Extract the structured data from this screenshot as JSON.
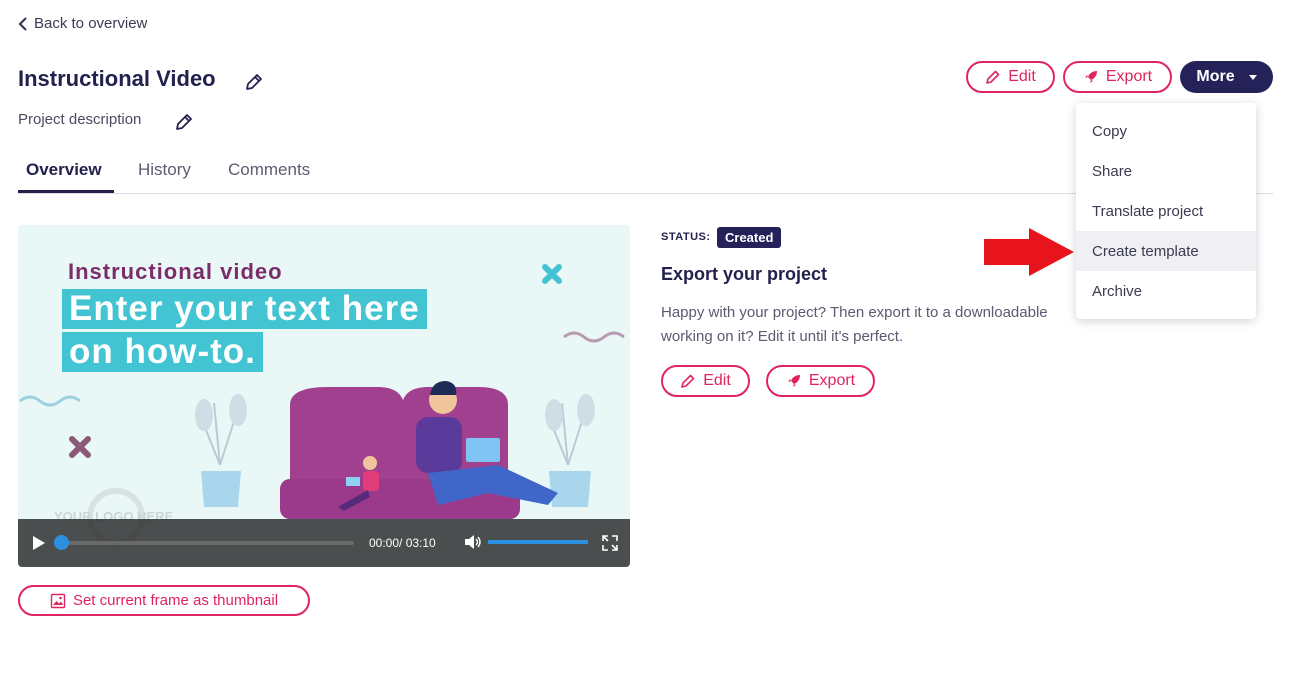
{
  "back_label": "Back to overview",
  "project": {
    "title": "Instructional Video",
    "description": "Project description"
  },
  "tabs": [
    {
      "label": "Overview"
    },
    {
      "label": "History"
    },
    {
      "label": "Comments"
    }
  ],
  "actions": {
    "edit_label": "Edit",
    "export_label": "Export",
    "more_label": "More"
  },
  "more_menu": [
    {
      "label": "Copy"
    },
    {
      "label": "Share"
    },
    {
      "label": "Translate project"
    },
    {
      "label": "Create template"
    },
    {
      "label": "Archive"
    }
  ],
  "video": {
    "subtitle": "Instructional video",
    "line1": "Enter your text here",
    "line2": "on how-to.",
    "logo_placeholder": "YOUR LOGO HERE",
    "time": "00:00/ 03:10"
  },
  "export_panel": {
    "status_label": "STATUS:",
    "status": "Created",
    "title": "Export your project",
    "description": "Happy with your project? Then export it to a downloadable working on it? Edit it until it's perfect.",
    "edit_label": "Edit",
    "export_label": "Export"
  },
  "thumbnail_label": "Set current frame as thumbnail",
  "colors": {
    "accent": "#e0245e",
    "primary": "#25225a",
    "video_band": "#43c4d2",
    "arrow": "#e8141b"
  }
}
